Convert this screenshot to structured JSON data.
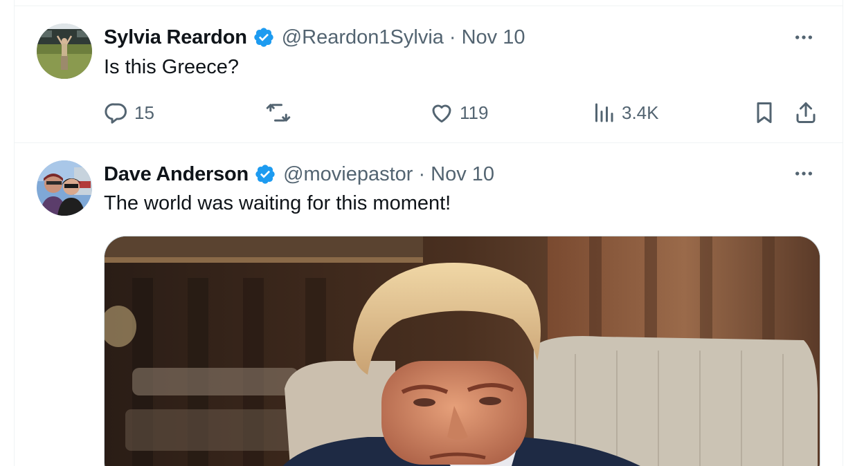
{
  "tweets": [
    {
      "author_name": "Sylvia Reardon",
      "handle": "@Reardon1Sylvia",
      "separator": "·",
      "date": "Nov 10",
      "text": "Is this Greece?",
      "verified": true,
      "stats": {
        "replies": "15",
        "retweets": "",
        "likes": "119",
        "views": "3.4K"
      }
    },
    {
      "author_name": "Dave Anderson",
      "handle": "@moviepastor",
      "separator": "·",
      "date": "Nov 10",
      "text": "The world was waiting for this moment!",
      "verified": true
    }
  ],
  "icons": {
    "verified": "verified-badge-icon",
    "more": "more-dots-icon",
    "reply": "reply-bubble-icon",
    "retweet": "retweet-icon",
    "like": "heart-icon",
    "views": "views-bars-icon",
    "bookmark": "bookmark-icon",
    "share": "share-upload-icon"
  },
  "colors": {
    "verified_blue": "#1d9bf0",
    "text_primary": "#0f1419",
    "text_secondary": "#536471",
    "divider": "#eff3f4"
  }
}
